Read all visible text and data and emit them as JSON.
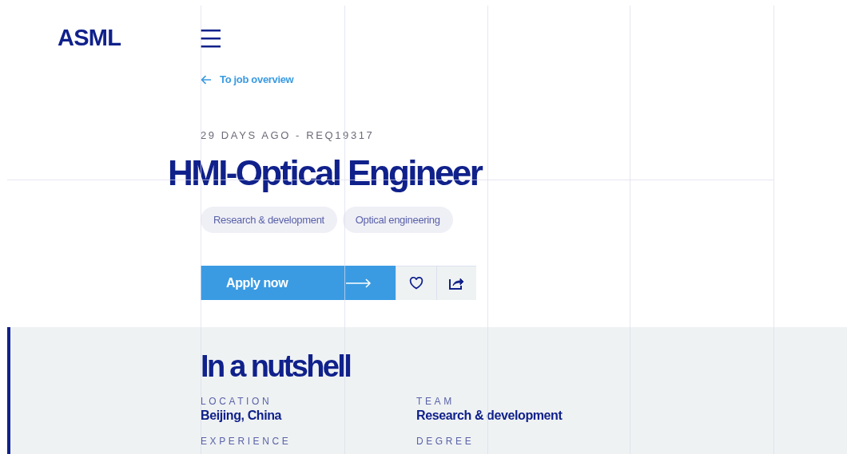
{
  "logo": "ASML",
  "back_link": "To job overview",
  "meta": "29 DAYS AGO - REQ19317",
  "title": "HMI-Optical Engineer",
  "tags": [
    "Research & development",
    "Optical engineering"
  ],
  "apply_button": "Apply now",
  "nutshell": {
    "heading": "In a nutshell",
    "facts": [
      {
        "label": "LOCATION",
        "value": "Beijing, China"
      },
      {
        "label": "TEAM",
        "value": "Research & development"
      },
      {
        "label": "EXPERIENCE"
      },
      {
        "label": "DEGREE"
      }
    ]
  }
}
